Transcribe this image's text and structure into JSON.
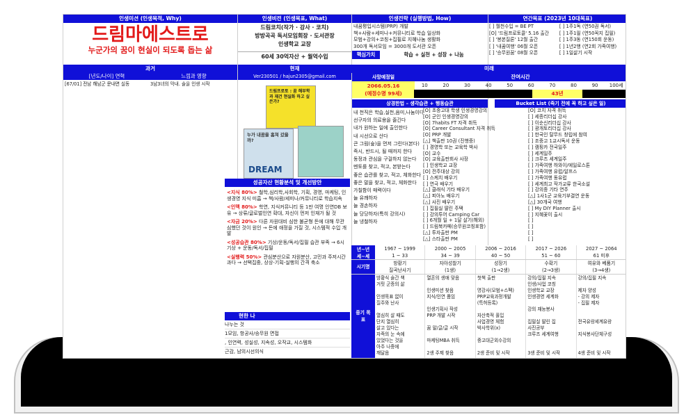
{
  "mission": {
    "header": "인생미션 (인생목적, Why)",
    "title": "드림마에스트로",
    "subtitle": "누군가의 꿈이 현실이 되도록 돕는 삶"
  },
  "vision": {
    "header": "인생비전 (인생목표, What)",
    "lines": [
      "드림코치(작가 · 강사 · 코치)",
      "방방곡곡 독서모임회장 · 도서관장",
      "인생학교 교장"
    ],
    "bar": "60세 30억자산 + 월억수입"
  },
  "strategy": {
    "header": "인생전략 (실행방법, How)",
    "lines": [
      "내꿈평입시스템(PRP) 개발",
      "책+사람+세미나+커뮤니티로 학습 일상화",
      "모범+강의+코칭+집필로 지혜나눔 생활화",
      "300개 독서모임 = 3000개 도서관 오픈"
    ],
    "core_label": "핵심가치",
    "core_values": "학습 + 실천 + 성장 + 나눔"
  },
  "annual": {
    "header": "연간목표 (2023년 10대목표)",
    "left": [
      "[ ] 월천수입 = BE PT",
      "[O] '드림프로토콜' 5.16 출간",
      "[ ] '봉본질론' 12월 출간",
      "[ ] '내꿈여행' 06월 오픈",
      "[ ] '승무원꿈' 08월 오픈"
    ],
    "right": [
      "[ ] 1주1독 (연50권 독서)",
      "[ ] 1주1필 (연50꼭지 집필)",
      "[ ] 1주3동 (연150회 운동)",
      "[ ] 1년2행 (연2회 가족여행)",
      "[ ] 1일삶기 시작"
    ]
  },
  "past": {
    "header": "과거",
    "col1": "[년도/나이] 연혁",
    "col2": "느낌과 영향",
    "row1a": "[67/01] 전남 해남군 문내면 실동",
    "row1b": "3남3녀의 막내. 술을 인생 시작"
  },
  "present": {
    "header": "현재",
    "contact": "Ver230501 / hajun2305@gmail.com",
    "book1": "드림프로토 : 꿈 해부학과 재건 현실화 하고 싶은가?",
    "book2": "누가 내꿈을 훔쳐 갔을까?",
    "book3": "DREAM"
  },
  "future": {
    "header": "미래",
    "death_label": "사망예정일",
    "death_date": "2066.05.16",
    "life_expect": "(예정수명 99세)",
    "remaining_label": "잔여시간",
    "ages": [
      "10",
      "20",
      "30",
      "40",
      "50",
      "60",
      "70",
      "80",
      "90",
      "100세"
    ],
    "years_left": "43년"
  },
  "habits": {
    "header": "상경한법 – 생각습관 + 행동습관",
    "items": [
      "내 천직은 학습,실천,음미,나눔이다",
      "선구자의 의료용을 줄긴다",
      "내가 원하는 일에 출인한다",
      "내 시선으로 산다",
      "큰 그림(숲)을 먼저 그린다(본다)",
      "즉시, 반드시, 될 때까지 한다",
      "동정과 관심을 구걸하지 않는다",
      "멘토를 찾고, 적고, 본받는다",
      "좋은 습관를 찾고, 적고, 체화한다",
      "좋은 말을 찾고, 적고, 체화한다",
      "가칠함이 매력이다",
      "늘 유쾌하자",
      "늘 경손하자",
      "늘 당당하자(특히 강의시)",
      "늘 냉철하자"
    ]
  },
  "bucket": {
    "header": "Bucket List (죽기 전에 꼭 하고 싶은 일)",
    "left": [
      "[O] 초중고대 학생 인생경영강의",
      "[O] 군인 인생경영강의",
      "[O] 7habits FT 자격 취득",
      "[O] Career Consultant 자격 취득",
      "[O] PRP 개발",
      "[△] 책출판 10권 (진행중)",
      "[ ] 경영학 또는 교육학 박사",
      "[O] 교수",
      "[O] 교육출판회사 사장",
      "[ ] 인생학교 교장",
      "[O] 전주대상 강의",
      "[ ] 스케치 배우기",
      "[ ] 연극 배우기",
      "[△] 클래식 기타 배우기",
      "[△] 피아노 배우기",
      "[△] 사진 배우기",
      "[ ] 집필실 딸린 주택",
      "[ ] 강의투어 Camping Car",
      "[ ] 6개월 일 + 1달 살기(해외)",
      "[ ] 드림북카페(승무원코칭포함)",
      "[△] 투자출판 PM",
      "[△] 스타출판 PM"
    ],
    "right": [
      "[O] 코치 자격 취득",
      "[ ] 세종리더십 강사",
      "[ ] 이순신리더십 강사",
      "[ ] 광개토리더십 강사",
      "[ ] 한국인 탈무드 창립에 참여",
      "[ ] 조중고 1교시독서 운동",
      "[ ] 캠핑카 전국일주",
      "[ ] 세계일주",
      "[ ] 크루즈 세계일주",
      "[ ] 가족여행 하와이/에일로스톤",
      "[ ] 가족여행 유럽/알프스",
      "[ ] 가족여행 동유럽",
      "[ ] 세계최고 작가교류 한국소설",
      "[ ] 강의중 기타 연주",
      "[△] 1사1군 교육기부결연 운동",
      "[△] 30개국 여행",
      "[ ] My DIY Planner 출시",
      "[ ] 지혜꽃이 출시",
      "[ ]",
      "[ ]",
      "[ ]",
      "[ ]"
    ]
  },
  "assets": {
    "header": "성공자산 현황분석 및 개선방안",
    "items": [
      {
        "title": "<지식 80%>",
        "text": "철학,심리학,사회학, 기획, 경영, 마케팅, 인생경영 지식 미흡 → 책/사람/세미나/커뮤니티로 학습지속"
      },
      {
        "title": "<인맥 80%>",
        "text": "학연, 지식커뮤니티 등 1만 여명 인연DB 보유 → 상류/글로벌인연 확대, 자신이 먼저 인재가 될 것"
      },
      {
        "title": "<자금 20%>",
        "text": "다른 자원대비 심한 불균형 돈에 대해 무관심했던 것이 원인 → 돈에 애정을 가질 것, 시스템적 수입 개발"
      },
      {
        "title": "<성공습관 80%>",
        "text": "기상/운동/독서/집필 습관 부족 → 6시기상 + 운동/독서/집필"
      },
      {
        "title": "<실행력 50%>",
        "text": "관심분산으로 자원분산, 고민과 주저시간 과다 → 선택집중, 상상-기획-실행의 간격 축소"
      }
    ]
  },
  "me": {
    "header": "현한 나",
    "lines": [
      "나누는 것",
      "1모임, 항공사/승무원 면접",
      ", 인연력, 성실성, 지속성, 오작교, 시스템화",
      "근감, 남의시선의식"
    ]
  },
  "timeline": {
    "label1": "년~년",
    "label2": "세~세",
    "periods": [
      "1967 ~ 1999",
      "2000 ~ 2005",
      "2006 ~ 2016",
      "2017 ~ 2026",
      "2027 ~ 2064"
    ],
    "ages": [
      "1 ~ 33",
      "34 ~ 39",
      "40 ~ 50",
      "51 ~ 60",
      "61 미후"
    ],
    "era_label": "시기명",
    "era_names": [
      "방황기",
      "자아성찰기",
      "성장기",
      "수확기",
      "여유와 베품기"
    ],
    "era_sub": [
      "질곡난사기",
      "(1생)",
      "(1→2생)",
      "(2→3생)",
      "(3→4생)"
    ],
    "goal_label": "중기 목표",
    "goals": [
      [
        "방황식 술간 책",
        "거핏 군종의 삶",
        "",
        "인생목표 없이",
        "질주와 난사",
        "",
        "열심히 살 때도",
        "단지 열심히",
        "살고 있다는",
        "자족의 눈 속에",
        "있었다는 것을",
        "아주 나중에",
        "깨달음"
      ],
      [
        "열혼의 생애 맞음",
        "",
        "인생미션 찾음",
        "지식/인연 품임",
        "",
        "인생기획사 작성",
        "PRP 개발 시작",
        "",
        "꿈 말/글/글 시작",
        "",
        "마케팅MBA 취득",
        "",
        "2생 주제 찾음"
      ],
      [
        "첫책 출판",
        "",
        "명강사(모범+스펙)",
        "PRP교육과정개발",
        "(특허등록)",
        "",
        "자산축적 풀입",
        "사업경영 체험",
        "박사학위(x)",
        "",
        "중고대군외수강의",
        "",
        "2생 준비 및 시작"
      ],
      [
        "강의/집필 지속",
        "인생/사업 코칭",
        "인생학교 교장",
        "인생경영 세계화",
        "",
        "강의 재능봉사",
        "",
        "집필실 딸린 집",
        "사진공부",
        "크루즈 세계여행",
        "",
        "",
        "3생 준비 및 시작"
      ],
      [
        "강의/집필 지속",
        "",
        "제자 양성",
        "- 강의 제자",
        "- 집필 제자",
        "",
        "",
        "전국유랑세계유랑",
        "",
        "지식봉사단체구성",
        "",
        "",
        "4생 준비 및 시작"
      ]
    ]
  },
  "colors": {
    "blue": "#1010d8",
    "red": "#e21a1a",
    "yellow": "#ffff66"
  }
}
